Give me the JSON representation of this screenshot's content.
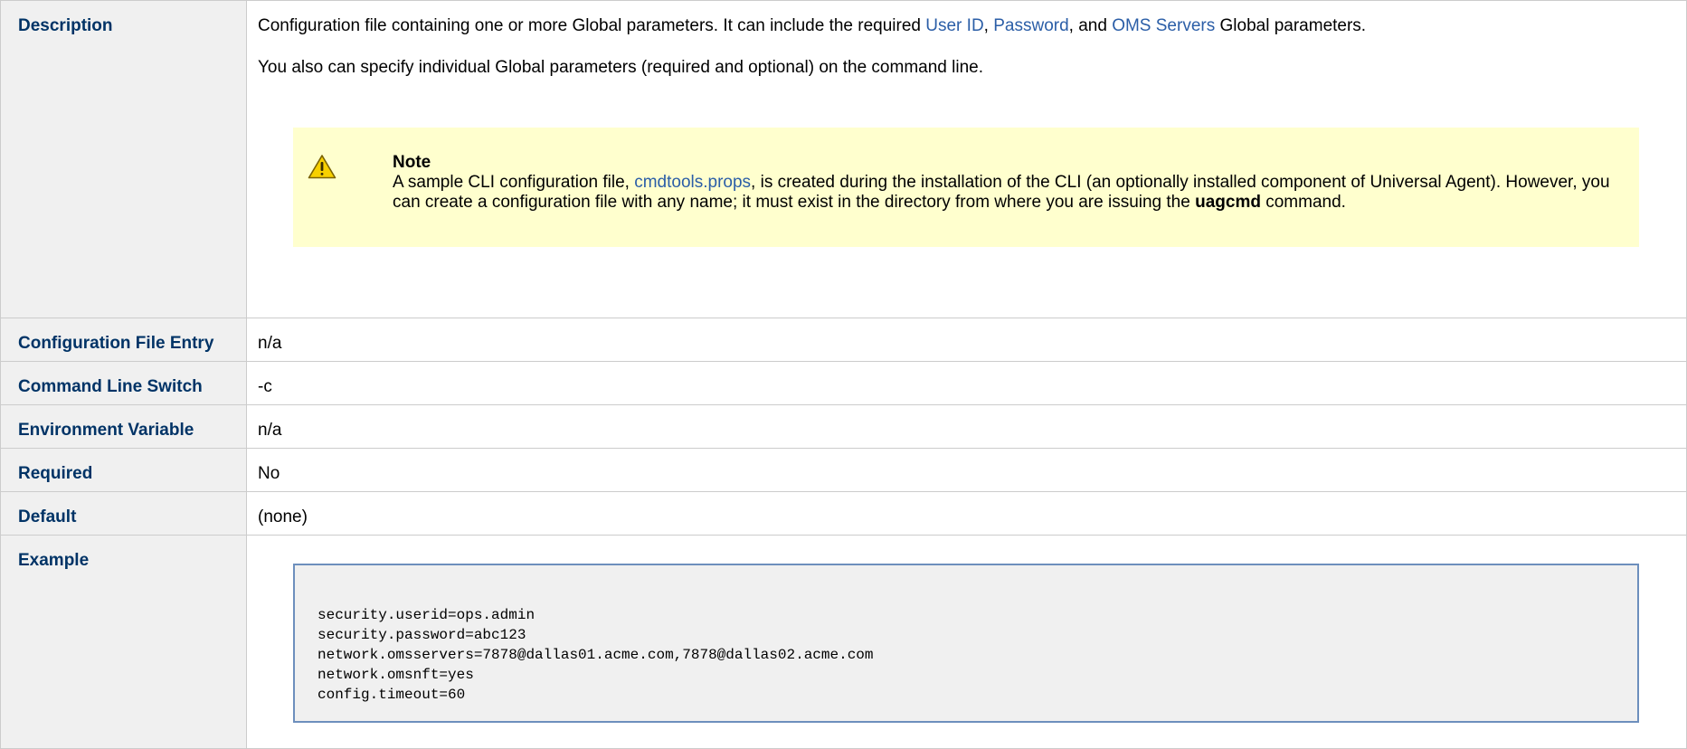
{
  "rows": {
    "description": {
      "label": "Description",
      "p1_before": "Configuration file containing one or more Global parameters. It can include the required ",
      "link_userid": "User ID",
      "p1_sep1": ", ",
      "link_password": "Password",
      "p1_sep2": ", and ",
      "link_omsservers": "OMS Servers",
      "p1_after": " Global parameters.",
      "p2": "You also can specify individual Global parameters (required and optional) on the command line.",
      "note": {
        "icon": "warning-icon",
        "title": "Note",
        "body_before": "A sample CLI configuration file, ",
        "link_file": "cmdtools.props",
        "body_mid": ", is created during the installation of the CLI (an optionally installed component of Universal Agent). However, you can create a configuration file with any name; it must exist in the directory from where you are issuing the ",
        "body_bold": "uagcmd",
        "body_after": " command."
      }
    },
    "config_entry": {
      "label": "Configuration File Entry",
      "value": "n/a"
    },
    "cmd_switch": {
      "label": "Command Line Switch",
      "value": "-c"
    },
    "env_var": {
      "label": "Environment Variable",
      "value": "n/a"
    },
    "required": {
      "label": "Required",
      "value": "No"
    },
    "default": {
      "label": "Default",
      "value": "(none)"
    },
    "example": {
      "label": "Example",
      "code_lines": [
        "security.userid=ops.admin",
        "security.password=abc123",
        "network.omsservers=7878@dallas01.acme.com,7878@dallas02.acme.com",
        "network.omsnft=yes",
        "config.timeout=60"
      ]
    }
  },
  "colors": {
    "label_text": "#003366",
    "link": "#2b5ea7",
    "note_bg": "#ffffce",
    "code_border": "#6d8fbd"
  }
}
